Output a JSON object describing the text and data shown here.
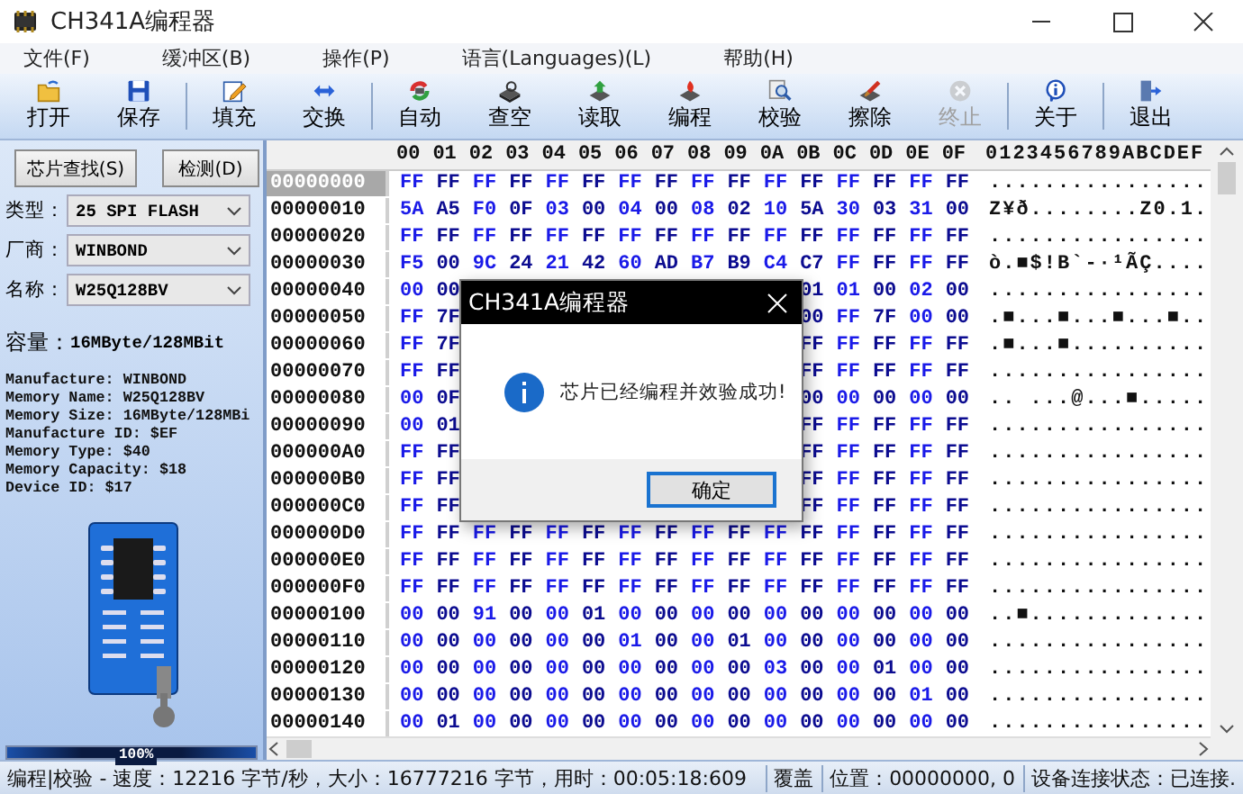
{
  "window": {
    "title": "CH341A编程器"
  },
  "menu": [
    "文件(F)",
    "缓冲区(B)",
    "操作(P)",
    "语言(Languages)(L)",
    "帮助(H)"
  ],
  "toolbar": [
    {
      "kind": "button",
      "label": "打开",
      "disabled": false
    },
    {
      "kind": "button",
      "label": "保存",
      "disabled": false
    },
    {
      "kind": "separator"
    },
    {
      "kind": "button",
      "label": "填充",
      "disabled": false
    },
    {
      "kind": "button",
      "label": "交换",
      "disabled": false
    },
    {
      "kind": "separator"
    },
    {
      "kind": "button",
      "label": "自动",
      "disabled": false
    },
    {
      "kind": "button",
      "label": "查空",
      "disabled": false
    },
    {
      "kind": "button",
      "label": "读取",
      "disabled": false
    },
    {
      "kind": "button",
      "label": "编程",
      "disabled": false
    },
    {
      "kind": "button",
      "label": "校验",
      "disabled": false
    },
    {
      "kind": "button",
      "label": "擦除",
      "disabled": false
    },
    {
      "kind": "button",
      "label": "终止",
      "disabled": true
    },
    {
      "kind": "separator"
    },
    {
      "kind": "button",
      "label": "关于",
      "disabled": false
    },
    {
      "kind": "separator"
    },
    {
      "kind": "button",
      "label": "退出",
      "disabled": false
    }
  ],
  "sidebar": {
    "buttons": [
      "芯片查找(S)",
      "检测(D)"
    ],
    "fields": [
      {
        "label": "类型：",
        "value": "25 SPI FLASH"
      },
      {
        "label": "厂商：",
        "value": "WINBOND"
      },
      {
        "label": "名称：",
        "value": "W25Q128BV"
      }
    ],
    "capacity": {
      "label": "容量：",
      "value": "16MByte/128MBit"
    },
    "info": [
      "Manufacture: WINBOND",
      "Memory Name: W25Q128BV",
      "Memory Size: 16MByte/128MBi",
      "Manufacture ID: $EF",
      "Memory Type: $40",
      "Memory Capacity: $18",
      "Device ID: $17"
    ],
    "progress": {
      "level": 1,
      "label": "100%"
    }
  },
  "hex": {
    "columns": [
      "00",
      "01",
      "02",
      "03",
      "04",
      "05",
      "06",
      "07",
      "08",
      "09",
      "0A",
      "0B",
      "0C",
      "0D",
      "0E",
      "0F"
    ],
    "ascii_header": "0123456789ABCDEF",
    "rows": [
      {
        "address": "00000000",
        "selected": true,
        "bytes": [
          "FF",
          "FF",
          "FF",
          "FF",
          "FF",
          "FF",
          "FF",
          "FF",
          "FF",
          "FF",
          "FF",
          "FF",
          "FF",
          "FF",
          "FF",
          "FF"
        ],
        "ascii": "................"
      },
      {
        "address": "00000010",
        "selected": false,
        "bytes": [
          "5A",
          "A5",
          "F0",
          "0F",
          "03",
          "00",
          "04",
          "00",
          "08",
          "02",
          "10",
          "5A",
          "30",
          "03",
          "31",
          "00"
        ],
        "ascii": "Z¥ð........Z0.1."
      },
      {
        "address": "00000020",
        "selected": false,
        "bytes": [
          "FF",
          "FF",
          "FF",
          "FF",
          "FF",
          "FF",
          "FF",
          "FF",
          "FF",
          "FF",
          "FF",
          "FF",
          "FF",
          "FF",
          "FF",
          "FF"
        ],
        "ascii": "................"
      },
      {
        "address": "00000030",
        "selected": false,
        "bytes": [
          "F5",
          "00",
          "9C",
          "24",
          "21",
          "42",
          "60",
          "AD",
          "B7",
          "B9",
          "C4",
          "C7",
          "FF",
          "FF",
          "FF",
          "FF"
        ],
        "ascii": "ò.■$!B`-·¹ÃÇ...."
      },
      {
        "address": "00000040",
        "selected": false,
        "bytes": [
          "00",
          "00"
        ],
        "bytes_end": [
          "01",
          "01",
          "00",
          "02",
          "00"
        ],
        "ascii": "................"
      },
      {
        "address": "00000050",
        "selected": false,
        "bytes": [
          "FF",
          "7F"
        ],
        "bytes_end": [
          "00",
          "FF",
          "7F",
          "00",
          "00"
        ],
        "ascii": ".■...■...■...■.."
      },
      {
        "address": "00000060",
        "selected": false,
        "bytes": [
          "FF",
          "7F"
        ],
        "bytes_end": [
          "FF",
          "FF",
          "FF",
          "FF",
          "FF"
        ],
        "ascii": ".■...■.........."
      },
      {
        "address": "00000070",
        "selected": false,
        "bytes": [
          "FF",
          "FF"
        ],
        "bytes_end": [
          "FF",
          "FF",
          "FF",
          "FF",
          "FF"
        ],
        "ascii": "................"
      },
      {
        "address": "00000080",
        "selected": false,
        "bytes": [
          "00",
          "0F"
        ],
        "bytes_end": [
          "00",
          "00",
          "00",
          "00",
          "00"
        ],
        "ascii": ".. ...@...■....."
      },
      {
        "address": "00000090",
        "selected": false,
        "bytes": [
          "00",
          "01"
        ],
        "bytes_end": [
          "FF",
          "FF",
          "FF",
          "FF",
          "FF"
        ],
        "ascii": "................"
      },
      {
        "address": "000000A0",
        "selected": false,
        "bytes": [
          "FF",
          "FF"
        ],
        "bytes_end": [
          "FF",
          "FF",
          "FF",
          "FF",
          "FF"
        ],
        "ascii": "................"
      },
      {
        "address": "000000B0",
        "selected": false,
        "bytes": [
          "FF",
          "FF"
        ],
        "bytes_end": [
          "FF",
          "FF",
          "FF",
          "FF",
          "FF"
        ],
        "ascii": "................"
      },
      {
        "address": "000000C0",
        "selected": false,
        "bytes": [
          "FF",
          "FF"
        ],
        "bytes_end": [
          "FF",
          "FF",
          "FF",
          "FF",
          "FF"
        ],
        "ascii": "................"
      },
      {
        "address": "000000D0",
        "selected": false,
        "bytes": [
          "FF",
          "FF",
          "FF",
          "FF",
          "FF",
          "FF",
          "FF",
          "FF",
          "FF",
          "FF",
          "FF",
          "FF",
          "FF",
          "FF",
          "FF",
          "FF"
        ],
        "ascii": "................"
      },
      {
        "address": "000000E0",
        "selected": false,
        "bytes": [
          "FF",
          "FF",
          "FF",
          "FF",
          "FF",
          "FF",
          "FF",
          "FF",
          "FF",
          "FF",
          "FF",
          "FF",
          "FF",
          "FF",
          "FF",
          "FF"
        ],
        "ascii": "................"
      },
      {
        "address": "000000F0",
        "selected": false,
        "bytes": [
          "FF",
          "FF",
          "FF",
          "FF",
          "FF",
          "FF",
          "FF",
          "FF",
          "FF",
          "FF",
          "FF",
          "FF",
          "FF",
          "FF",
          "FF",
          "FF"
        ],
        "ascii": "................"
      },
      {
        "address": "00000100",
        "selected": false,
        "bytes": [
          "00",
          "00",
          "91",
          "00",
          "00",
          "01",
          "00",
          "00",
          "00",
          "00",
          "00",
          "00",
          "00",
          "00",
          "00",
          "00"
        ],
        "ascii": "..■............."
      },
      {
        "address": "00000110",
        "selected": false,
        "bytes": [
          "00",
          "00",
          "00",
          "00",
          "00",
          "00",
          "01",
          "00",
          "00",
          "01",
          "00",
          "00",
          "00",
          "00",
          "00",
          "00"
        ],
        "ascii": "................"
      },
      {
        "address": "00000120",
        "selected": false,
        "bytes": [
          "00",
          "00",
          "00",
          "00",
          "00",
          "00",
          "00",
          "00",
          "00",
          "00",
          "03",
          "00",
          "00",
          "01",
          "00",
          "00"
        ],
        "ascii": "................"
      },
      {
        "address": "00000130",
        "selected": false,
        "bytes": [
          "00",
          "00",
          "00",
          "00",
          "00",
          "00",
          "00",
          "00",
          "00",
          "00",
          "00",
          "00",
          "00",
          "00",
          "01",
          "00"
        ],
        "ascii": "................"
      },
      {
        "address": "00000140",
        "selected": false,
        "bytes": [
          "00",
          "01",
          "00",
          "00",
          "00",
          "00",
          "00",
          "00",
          "00",
          "00",
          "00",
          "00",
          "00",
          "00",
          "00",
          "00"
        ],
        "ascii": "................"
      }
    ]
  },
  "status_bar": [
    "编程|校验 - 速度：12216 字节/秒，大小：16777216 字节，用时：00:05:18:609",
    "覆盖",
    "位置：00000000, 0",
    "设备连接状态：已连接."
  ],
  "dialog": {
    "title": "CH341A编程器",
    "message": "芯片已经编程并效验成功!",
    "button": "确定"
  }
}
